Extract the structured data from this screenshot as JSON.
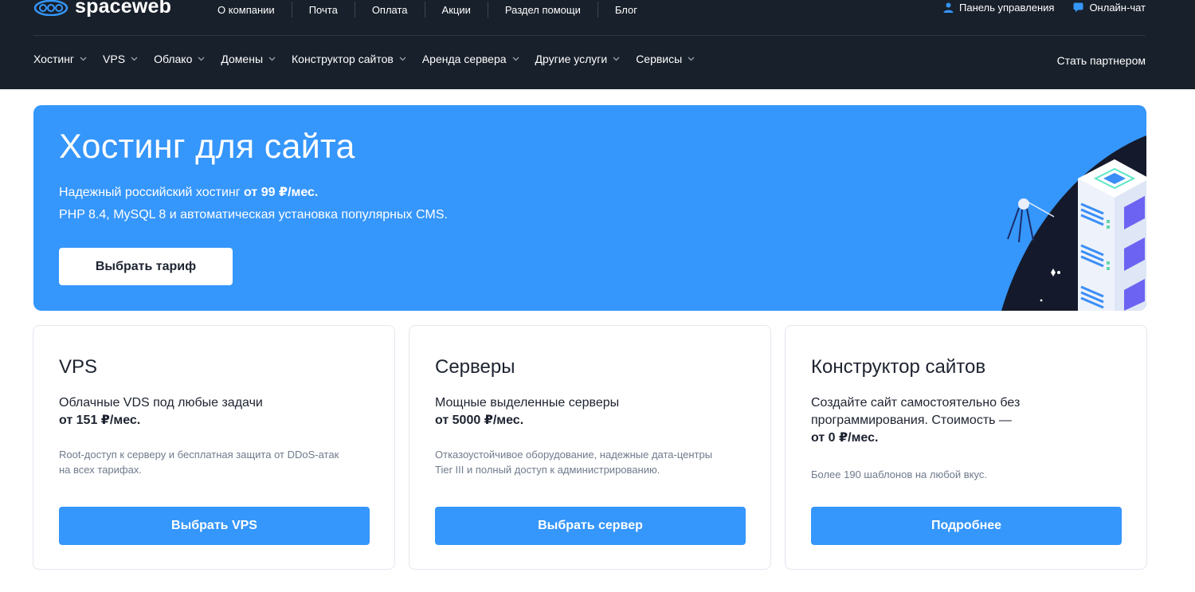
{
  "logo": {
    "text": "spaceweb"
  },
  "top_links": [
    "О компании",
    "Почта",
    "Оплата",
    "Акции",
    "Раздел помощи",
    "Блог"
  ],
  "top_right": {
    "panel": "Панель управления",
    "chat": "Онлайн-чат"
  },
  "main_nav": [
    "Хостинг",
    "VPS",
    "Облако",
    "Домены",
    "Конструктор сайтов",
    "Аренда сервера",
    "Другие услуги",
    "Сервисы"
  ],
  "partner": "Стать партнером",
  "hero": {
    "title": "Хостинг для сайта",
    "line1_text": "Надежный российский хостинг ",
    "line1_price": "от 99 ₽/мес.",
    "line2": "PHP 8.4, MySQL 8 и автоматическая установка популярных CMS.",
    "button": "Выбрать тариф"
  },
  "cards": [
    {
      "title": "VPS",
      "desc": "Облачные VDS под любые задачи",
      "price": "от 151 ₽/мес.",
      "note": "Root-доступ к серверу и бесплатная защита от DDoS-атак на всех тарифах.",
      "button": "Выбрать VPS"
    },
    {
      "title": "Серверы",
      "desc": "Мощные выделенные серверы",
      "price": "от 5000 ₽/мес.",
      "note": "Отказоустойчивое оборудование, надежные дата-центры Tier III и полный доступ к администрированию.",
      "button": "Выбрать сервер"
    },
    {
      "title": "Конструктор сайтов",
      "desc": "Создайте сайт самостоятельно без программирования. Стоимость —",
      "price": "от 0 ₽/мес.",
      "note": "Более 190 шаблонов на любой вкус.",
      "button": "Подробнее"
    }
  ],
  "colors": {
    "header_bg": "#18202b",
    "accent": "#3596fb"
  }
}
